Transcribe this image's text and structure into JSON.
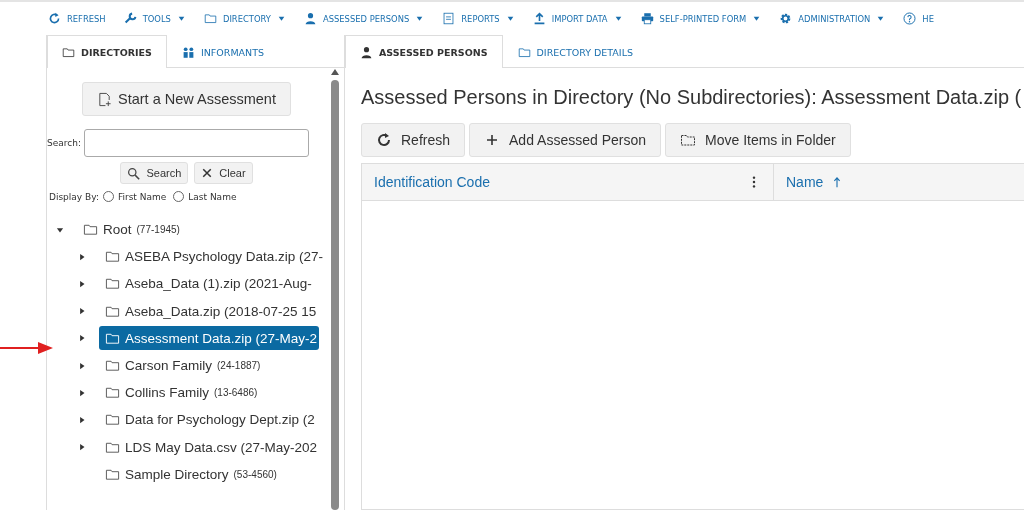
{
  "toolbar": [
    {
      "label": "REFRESH",
      "dropdown": false
    },
    {
      "label": "TOOLS",
      "dropdown": true
    },
    {
      "label": "DIRECTORY",
      "dropdown": true
    },
    {
      "label": "ASSESSED PERSONS",
      "dropdown": true
    },
    {
      "label": "REPORTS",
      "dropdown": true
    },
    {
      "label": "IMPORT DATA",
      "dropdown": true
    },
    {
      "label": "SELF-PRINTED FORM",
      "dropdown": true
    },
    {
      "label": "ADMINISTRATION",
      "dropdown": true
    },
    {
      "label": "HE",
      "dropdown": false
    }
  ],
  "sidebar": {
    "tabs": [
      {
        "label": "DIRECTORIES",
        "selected": true
      },
      {
        "label": "INFORMANTS",
        "selected": false
      }
    ],
    "new_button": "Start a New Assessment",
    "search": {
      "label": "Search:",
      "search_button": "Search",
      "clear_button": "Clear"
    },
    "display_by": {
      "label": "Display By:",
      "options": [
        {
          "label": "First Name",
          "selected": false
        },
        {
          "label": "Last Name",
          "selected": false
        }
      ]
    },
    "tree": [
      {
        "label": "Root",
        "count": "(77-1945)",
        "kind": "expanded",
        "selected": false,
        "children": [
          {
            "label": "ASEBA Psychology Data.zip (27-",
            "kind": "collapsed",
            "selected": false
          },
          {
            "label": "Aseba_Data (1).zip (2021-Aug-",
            "kind": "collapsed",
            "selected": false
          },
          {
            "label": "Aseba_Data.zip (2018-07-25 15",
            "kind": "collapsed",
            "selected": false
          },
          {
            "label": "Assessment Data.zip (27-May-2",
            "kind": "collapsed",
            "selected": true
          },
          {
            "label": "Carson Family",
            "count": "(24-1887)",
            "kind": "collapsed",
            "selected": false
          },
          {
            "label": "Collins Family",
            "count": "(13-6486)",
            "kind": "collapsed",
            "selected": false
          },
          {
            "label": "Data for Psychology Dept.zip (2",
            "kind": "collapsed",
            "selected": false
          },
          {
            "label": "LDS May Data.csv (27-May-202",
            "kind": "collapsed",
            "selected": false
          },
          {
            "label": "Sample Directory",
            "count": "(53-4560)",
            "kind": "leaf",
            "selected": false
          }
        ]
      }
    ]
  },
  "main": {
    "tabs": [
      {
        "label": "ASSESSED PERSONS",
        "selected": true
      },
      {
        "label": "DIRECTORY DETAILS",
        "selected": false
      }
    ],
    "title": "Assessed Persons in Directory (No Subdirectories):  Assessment Data.zip (",
    "buttons": [
      {
        "label": "Refresh"
      },
      {
        "label": "Add Assessed Person"
      },
      {
        "label": "Move Items in Folder"
      }
    ],
    "columns": [
      {
        "label": "Identification Code",
        "kind": "menu"
      },
      {
        "label": "Name",
        "kind": "sorted"
      }
    ]
  }
}
